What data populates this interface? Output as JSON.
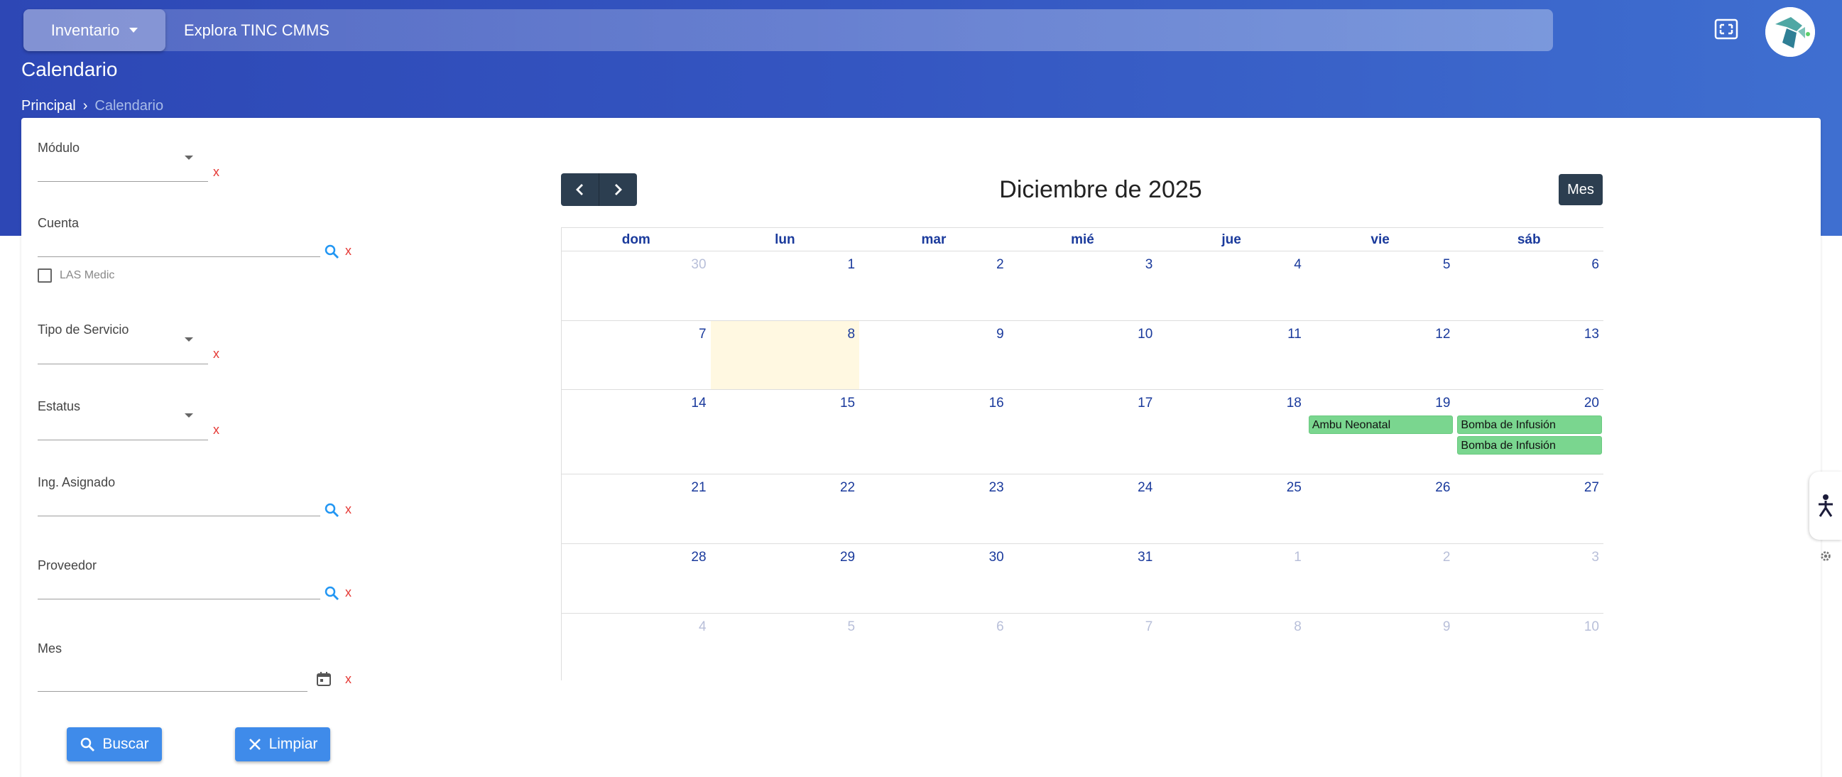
{
  "topbar": {
    "module_label": "Inventario",
    "explore_text": "Explora TINC CMMS"
  },
  "header": {
    "title": "Calendario",
    "breadcrumb": [
      "Principal",
      "Calendario"
    ],
    "breadcrumb_separator": "›"
  },
  "filters": {
    "modulo_label": "Módulo",
    "cuenta_label": "Cuenta",
    "las_medic_label": "LAS Medic",
    "tipo_servicio_label": "Tipo de Servicio",
    "estatus_label": "Estatus",
    "ing_asignado_label": "Ing. Asignado",
    "proveedor_label": "Proveedor",
    "mes_label": "Mes",
    "clear_symbol": "x",
    "search_button": "Buscar",
    "clear_button": "Limpiar"
  },
  "calendar": {
    "title": "Diciembre de 2025",
    "view_button": "Mes",
    "day_names": [
      "dom",
      "lun",
      "mar",
      "mié",
      "jue",
      "vie",
      "sáb"
    ],
    "weeks": [
      [
        {
          "n": "30",
          "other": true
        },
        {
          "n": "1"
        },
        {
          "n": "2"
        },
        {
          "n": "3"
        },
        {
          "n": "4"
        },
        {
          "n": "5"
        },
        {
          "n": "6"
        }
      ],
      [
        {
          "n": "7"
        },
        {
          "n": "8",
          "today": true
        },
        {
          "n": "9"
        },
        {
          "n": "10"
        },
        {
          "n": "11"
        },
        {
          "n": "12"
        },
        {
          "n": "13"
        }
      ],
      [
        {
          "n": "14"
        },
        {
          "n": "15"
        },
        {
          "n": "16"
        },
        {
          "n": "17"
        },
        {
          "n": "18"
        },
        {
          "n": "19"
        },
        {
          "n": "20"
        }
      ],
      [
        {
          "n": "21"
        },
        {
          "n": "22"
        },
        {
          "n": "23"
        },
        {
          "n": "24"
        },
        {
          "n": "25"
        },
        {
          "n": "26"
        },
        {
          "n": "27"
        }
      ],
      [
        {
          "n": "28"
        },
        {
          "n": "29"
        },
        {
          "n": "30"
        },
        {
          "n": "31"
        },
        {
          "n": "1",
          "other": true
        },
        {
          "n": "2",
          "other": true
        },
        {
          "n": "3",
          "other": true
        }
      ],
      [
        {
          "n": "4",
          "other": true
        },
        {
          "n": "5",
          "other": true
        },
        {
          "n": "6",
          "other": true
        },
        {
          "n": "7",
          "other": true
        },
        {
          "n": "8",
          "other": true
        },
        {
          "n": "9",
          "other": true
        },
        {
          "n": "10",
          "other": true
        }
      ]
    ],
    "events": [
      {
        "week": 2,
        "day": 5,
        "slot": 0,
        "title": "Ambu Neonatal"
      },
      {
        "week": 2,
        "day": 6,
        "slot": 0,
        "title": "Bomba de Infusión"
      },
      {
        "week": 2,
        "day": 6,
        "slot": 1,
        "title": "Bomba de Infusión"
      }
    ],
    "event_color": "#7ad68f"
  },
  "colors": {
    "header_gradient_start": "#2d47b5",
    "header_gradient_end": "#3f6fd0",
    "primary_button": "#3f8bea",
    "dark_button": "#2c3e50",
    "clear_x": "#e53935",
    "today_bg": "#fff8e1"
  },
  "icons": {
    "fullscreen": "fullscreen-icon",
    "avatar": "logo-avatar",
    "search": "search-icon",
    "calendar": "calendar-icon",
    "side_tab": "accessibility-icon",
    "gear": "gear-icon"
  }
}
